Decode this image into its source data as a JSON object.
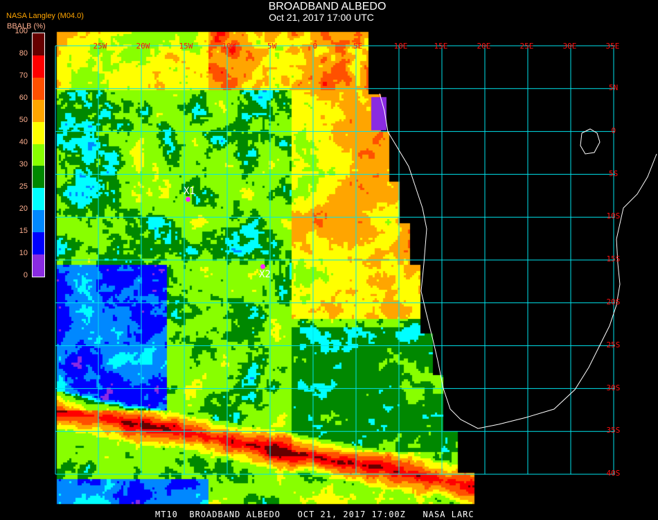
{
  "header": {
    "title": "BROADBAND ALBEDO",
    "subtitle": "Oct 21, 2017 17:00 UTC"
  },
  "source_label": "NASA Langley (M04.0)",
  "legend": {
    "label": "BBALB (%)",
    "ticks": [
      "0",
      "10",
      "15",
      "20",
      "25",
      "30",
      "40",
      "50",
      "60",
      "70",
      "80",
      "100"
    ],
    "colors": [
      "#8a2be2",
      "#0000ff",
      "#0088ff",
      "#00ffff",
      "#008800",
      "#88ff00",
      "#ffff00",
      "#ffa500",
      "#ff5000",
      "#ff0000",
      "#660000"
    ]
  },
  "grid": {
    "color": "#00e5ee",
    "lon_labels": [
      "25W",
      "20W",
      "15W",
      "10W",
      "5W",
      "0",
      "5E",
      "10E",
      "15E",
      "20E",
      "25E",
      "30E",
      "35E"
    ],
    "lat_labels": [
      "5N",
      "0",
      "5S",
      "10S",
      "15S",
      "20S",
      "25S",
      "30S",
      "35S",
      "40S"
    ]
  },
  "markers": [
    {
      "label": "X1"
    },
    {
      "label": "X2"
    }
  ],
  "footer": "MT10  BROADBAND ALBEDO   OCT 21, 2017 17:00Z   NASA LARC"
}
